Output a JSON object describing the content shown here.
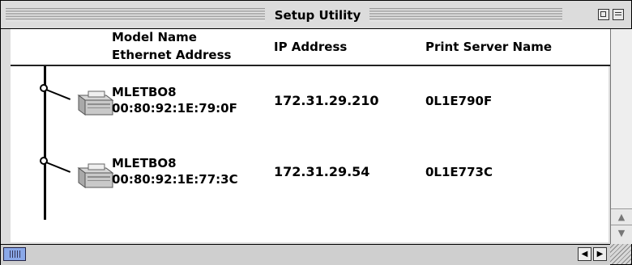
{
  "window": {
    "title": "Setup Utility"
  },
  "columns": {
    "model_name": "Model Name",
    "ethernet_address": "Ethernet Address",
    "ip_address": "IP Address",
    "print_server_name": "Print Server Name"
  },
  "devices": [
    {
      "model_name": "MLETBO8",
      "ethernet_address": "00:80:92:1E:79:0F",
      "ip_address": "172.31.29.210",
      "print_server_name": "0L1E790F",
      "icon": "printer-icon"
    },
    {
      "model_name": "MLETBO8",
      "ethernet_address": "00:80:92:1E:77:3C",
      "ip_address": "172.31.29.54",
      "print_server_name": "0L1E773C",
      "icon": "printer-icon"
    }
  ],
  "scrollbars": {
    "up_arrow": "▲",
    "down_arrow": "▼",
    "left_arrow": "◀",
    "right_arrow": "▶"
  }
}
